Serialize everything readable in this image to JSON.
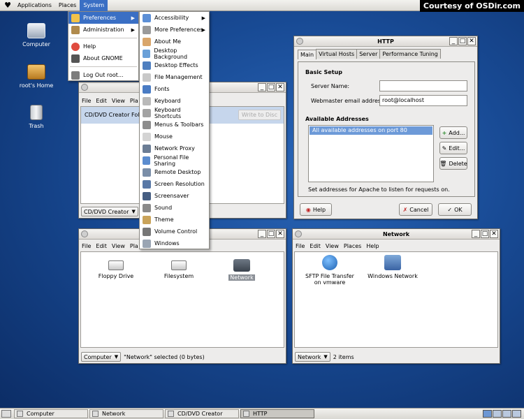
{
  "panel": {
    "applications": "Applications",
    "places": "Places",
    "system": "System",
    "courtesy": "Courtesy of OSDir.com"
  },
  "desktop_icons": [
    {
      "label": "Computer"
    },
    {
      "label": "root's Home"
    },
    {
      "label": "Trash"
    }
  ],
  "system_menu": {
    "items": [
      {
        "label": "Preferences",
        "icon": "preferences-icon"
      },
      {
        "label": "Administration",
        "icon": "administration-icon"
      },
      {
        "label": "Help",
        "icon": "help-icon"
      },
      {
        "label": "About GNOME",
        "icon": "gnome-foot-icon"
      },
      {
        "label": "Log Out root...",
        "icon": "logout-icon"
      }
    ]
  },
  "preferences_menu": {
    "items": [
      {
        "label": "Accessibility",
        "icon": "accessibility-icon",
        "sub": true
      },
      {
        "label": "More Preferences",
        "icon": "tools-icon",
        "sub": true
      },
      {
        "label": "About Me",
        "icon": "about-me-icon"
      },
      {
        "label": "Desktop Background",
        "icon": "desktop-background-icon"
      },
      {
        "label": "Desktop Effects",
        "icon": "desktop-effects-icon"
      },
      {
        "label": "File Management",
        "icon": "file-management-icon"
      },
      {
        "label": "Fonts",
        "icon": "fonts-icon"
      },
      {
        "label": "Keyboard",
        "icon": "keyboard-icon"
      },
      {
        "label": "Keyboard Shortcuts",
        "icon": "keyboard-shortcuts-icon"
      },
      {
        "label": "Menus & Toolbars",
        "icon": "menus-toolbars-icon"
      },
      {
        "label": "Mouse",
        "icon": "mouse-icon"
      },
      {
        "label": "Network Proxy",
        "icon": "network-proxy-icon"
      },
      {
        "label": "Personal File Sharing",
        "icon": "file-sharing-icon"
      },
      {
        "label": "Remote Desktop",
        "icon": "remote-desktop-icon"
      },
      {
        "label": "Screen Resolution",
        "icon": "screen-resolution-icon"
      },
      {
        "label": "Screensaver",
        "icon": "screensaver-icon"
      },
      {
        "label": "Sound",
        "icon": "sound-icon"
      },
      {
        "label": "Theme",
        "icon": "theme-icon"
      },
      {
        "label": "Volume Control",
        "icon": "volume-icon"
      },
      {
        "label": "Windows",
        "icon": "windows-icon"
      }
    ]
  },
  "cddvd_window": {
    "menu": [
      "File",
      "Edit",
      "View",
      "Pla"
    ],
    "folder_label": "CD/DVD Creator Folde",
    "write_btn": "Write to Disc",
    "location": "CD/DVD Creator"
  },
  "computer_window": {
    "menu": [
      "File",
      "Edit",
      "View",
      "Pla"
    ],
    "items": [
      {
        "label": "Floppy Drive"
      },
      {
        "label": "Filesystem"
      },
      {
        "label": "Network"
      }
    ],
    "location": "Computer",
    "status": "\"Network\" selected (0 bytes)"
  },
  "http_window": {
    "title": "HTTP",
    "tabs": [
      "Main",
      "Virtual Hosts",
      "Server",
      "Performance Tuning"
    ],
    "basic_setup": "Basic Setup",
    "server_name_label": "Server Name:",
    "server_name_value": "",
    "webmaster_label": "Webmaster email address:",
    "webmaster_value": "root@localhost",
    "available_addresses": "Available Addresses",
    "address_item": "All available addresses on port 80",
    "add": "Add...",
    "edit": "Edit...",
    "delete": "Delete",
    "hint": "Set addresses for Apache to listen for requests on.",
    "help": "Help",
    "cancel": "Cancel",
    "ok": "OK"
  },
  "network_window": {
    "title": "Network",
    "menu": [
      "File",
      "Edit",
      "View",
      "Places",
      "Help"
    ],
    "items": [
      {
        "label": "SFTP File Transfer on vmware"
      },
      {
        "label": "Windows Network"
      }
    ],
    "location": "Network",
    "status": "2 items"
  },
  "taskbar": {
    "items": [
      "Computer",
      "Network",
      "CD/DVD Creator",
      "HTTP"
    ]
  }
}
